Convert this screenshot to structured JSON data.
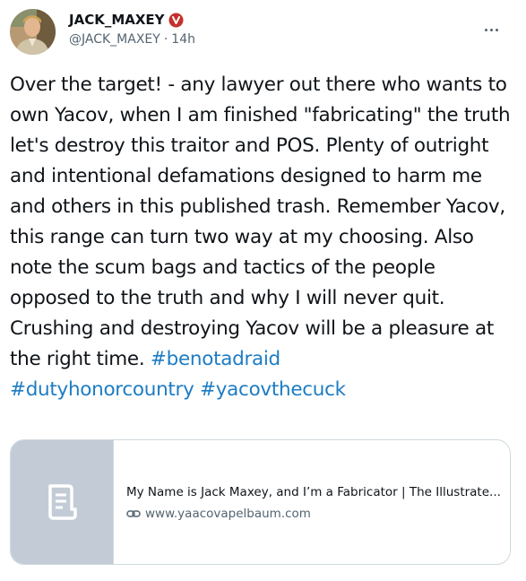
{
  "tweet": {
    "author": {
      "display_name": "JACK_MAXEY",
      "handle": "@JACK_MAXEY",
      "separator": "·",
      "time": "14h"
    },
    "text_parts": [
      {
        "type": "text",
        "value": "Over the target! - any lawyer out there who wants to own Yacov, when I am finished \"fabricating\" the truth let's destroy this traitor and POS. Plenty of outright and intentional defamations designed to harm me and others in this published trash. Remember Yacov, this range can turn two way at my choosing. Also note the scum bags and tactics of the people opposed to the truth and why I will never quit. Crushing and destroying Yacov will be a pleasure at the right time. "
      },
      {
        "type": "hashtag",
        "value": "#benotadraid"
      },
      {
        "type": "text",
        "value": " "
      },
      {
        "type": "hashtag",
        "value": "#dutyhonorcountry"
      },
      {
        "type": "text",
        "value": " "
      },
      {
        "type": "hashtag",
        "value": "#yacovthecuck"
      }
    ],
    "card": {
      "title": "My Name is Jack Maxey, and I’m a Fabricator | The Illustrate...",
      "domain": "www.yaacovapelbaum.com",
      "thumbnail_icon": "document-icon"
    }
  },
  "colors": {
    "text": "#0f1419",
    "secondary": "#536471",
    "hashtag": "#1d7cc3",
    "verified_badge": "#c4302b",
    "card_thumb": "#c3ccd6",
    "border": "#cfd9de"
  }
}
